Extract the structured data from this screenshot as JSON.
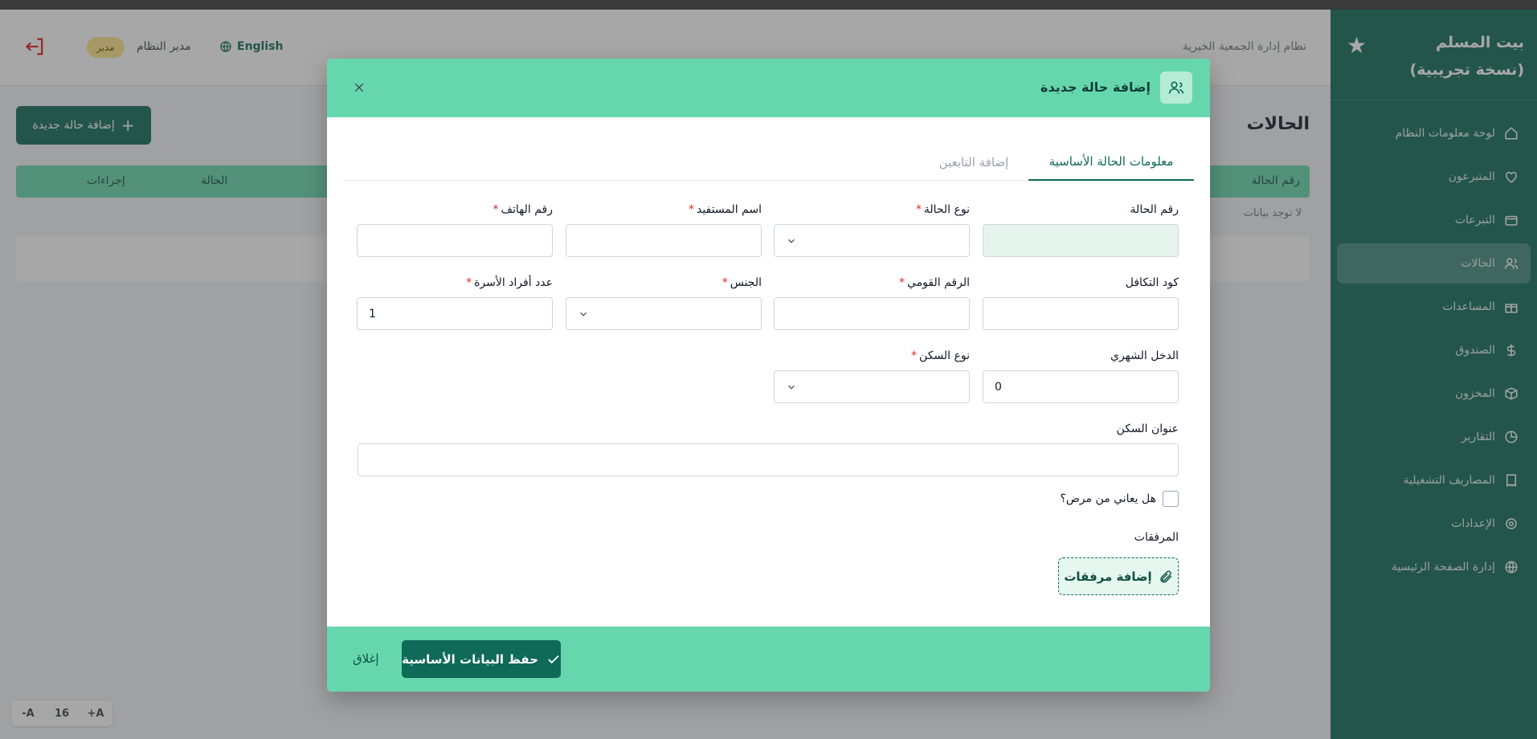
{
  "sidebar": {
    "brand": "بيت المسلم (نسخة تجريبية)",
    "items": [
      {
        "label": "لوحة معلومات النظام",
        "icon": "home-icon"
      },
      {
        "label": "المتبرعون",
        "icon": "heart-icon"
      },
      {
        "label": "التبرعات",
        "icon": "wallet-icon"
      },
      {
        "label": "الحالات",
        "icon": "users-icon",
        "active": true
      },
      {
        "label": "المساعدات",
        "icon": "gift-icon"
      },
      {
        "label": "الصندوق",
        "icon": "dollar-icon"
      },
      {
        "label": "المخزون",
        "icon": "box-icon"
      },
      {
        "label": "التقارير",
        "icon": "chart-icon"
      },
      {
        "label": "المصاريف التشغيلية",
        "icon": "receipt-icon"
      },
      {
        "label": "الإعدادات",
        "icon": "gear-icon"
      },
      {
        "label": "إدارة الصفحة الرئيسية",
        "icon": "globe-icon"
      }
    ]
  },
  "header": {
    "system_name": "نظام إدارة الجمعية الخيرية",
    "language": "English",
    "user_name": "مدير النظام",
    "role": "مدير"
  },
  "page": {
    "title": "الحالات",
    "add_button": "إضافة حالة جديدة",
    "columns": [
      "رقم الحالة",
      "الحالة",
      "إجراءات"
    ],
    "empty_text": "لا توجد بيانات"
  },
  "font_controls": {
    "decrease": "A-",
    "size": "16",
    "increase": "A+"
  },
  "modal": {
    "title": "إضافة حالة جديدة",
    "tabs": [
      "معلومات الحالة الأساسية",
      "إضافة التابعين"
    ],
    "fields": {
      "case_number": {
        "label": "رقم الحالة",
        "value": ""
      },
      "case_type": {
        "label": "نوع الحالة",
        "value": ""
      },
      "beneficiary_name": {
        "label": "اسم المستفيد",
        "value": ""
      },
      "phone": {
        "label": "رقم الهاتف",
        "value": ""
      },
      "sponsorship_code": {
        "label": "كود التكافل",
        "value": ""
      },
      "national_id": {
        "label": "الرقم القومي",
        "value": ""
      },
      "gender": {
        "label": "الجنس",
        "value": ""
      },
      "family_members": {
        "label": "عدد أفراد الأسرة",
        "value": "1"
      },
      "monthly_income": {
        "label": "الدخل الشهري",
        "value": "0"
      },
      "housing_type": {
        "label": "نوع السكن",
        "value": ""
      },
      "housing_address": {
        "label": "عنوان السكن",
        "value": ""
      }
    },
    "illness_question": "هل يعاني من مرض؟",
    "attachments_label": "المرفقات",
    "add_attachments": "إضافة مرفقات",
    "save_button": "حفظ البيانات الأساسية",
    "close_button": "إغلاق",
    "required_mark": "*"
  }
}
